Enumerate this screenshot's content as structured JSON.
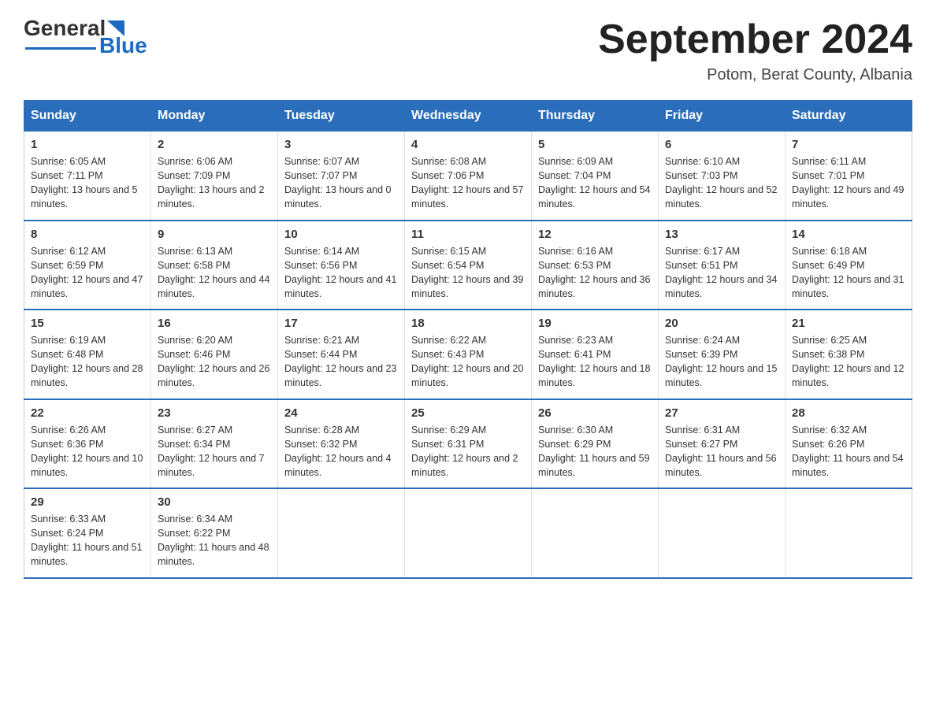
{
  "header": {
    "logo_general": "General",
    "logo_blue": "Blue",
    "month_title": "September 2024",
    "location": "Potom, Berat County, Albania"
  },
  "weekdays": [
    "Sunday",
    "Monday",
    "Tuesday",
    "Wednesday",
    "Thursday",
    "Friday",
    "Saturday"
  ],
  "weeks": [
    [
      {
        "day": "1",
        "sunrise": "6:05 AM",
        "sunset": "7:11 PM",
        "daylight": "13 hours and 5 minutes."
      },
      {
        "day": "2",
        "sunrise": "6:06 AM",
        "sunset": "7:09 PM",
        "daylight": "13 hours and 2 minutes."
      },
      {
        "day": "3",
        "sunrise": "6:07 AM",
        "sunset": "7:07 PM",
        "daylight": "13 hours and 0 minutes."
      },
      {
        "day": "4",
        "sunrise": "6:08 AM",
        "sunset": "7:06 PM",
        "daylight": "12 hours and 57 minutes."
      },
      {
        "day": "5",
        "sunrise": "6:09 AM",
        "sunset": "7:04 PM",
        "daylight": "12 hours and 54 minutes."
      },
      {
        "day": "6",
        "sunrise": "6:10 AM",
        "sunset": "7:03 PM",
        "daylight": "12 hours and 52 minutes."
      },
      {
        "day": "7",
        "sunrise": "6:11 AM",
        "sunset": "7:01 PM",
        "daylight": "12 hours and 49 minutes."
      }
    ],
    [
      {
        "day": "8",
        "sunrise": "6:12 AM",
        "sunset": "6:59 PM",
        "daylight": "12 hours and 47 minutes."
      },
      {
        "day": "9",
        "sunrise": "6:13 AM",
        "sunset": "6:58 PM",
        "daylight": "12 hours and 44 minutes."
      },
      {
        "day": "10",
        "sunrise": "6:14 AM",
        "sunset": "6:56 PM",
        "daylight": "12 hours and 41 minutes."
      },
      {
        "day": "11",
        "sunrise": "6:15 AM",
        "sunset": "6:54 PM",
        "daylight": "12 hours and 39 minutes."
      },
      {
        "day": "12",
        "sunrise": "6:16 AM",
        "sunset": "6:53 PM",
        "daylight": "12 hours and 36 minutes."
      },
      {
        "day": "13",
        "sunrise": "6:17 AM",
        "sunset": "6:51 PM",
        "daylight": "12 hours and 34 minutes."
      },
      {
        "day": "14",
        "sunrise": "6:18 AM",
        "sunset": "6:49 PM",
        "daylight": "12 hours and 31 minutes."
      }
    ],
    [
      {
        "day": "15",
        "sunrise": "6:19 AM",
        "sunset": "6:48 PM",
        "daylight": "12 hours and 28 minutes."
      },
      {
        "day": "16",
        "sunrise": "6:20 AM",
        "sunset": "6:46 PM",
        "daylight": "12 hours and 26 minutes."
      },
      {
        "day": "17",
        "sunrise": "6:21 AM",
        "sunset": "6:44 PM",
        "daylight": "12 hours and 23 minutes."
      },
      {
        "day": "18",
        "sunrise": "6:22 AM",
        "sunset": "6:43 PM",
        "daylight": "12 hours and 20 minutes."
      },
      {
        "day": "19",
        "sunrise": "6:23 AM",
        "sunset": "6:41 PM",
        "daylight": "12 hours and 18 minutes."
      },
      {
        "day": "20",
        "sunrise": "6:24 AM",
        "sunset": "6:39 PM",
        "daylight": "12 hours and 15 minutes."
      },
      {
        "day": "21",
        "sunrise": "6:25 AM",
        "sunset": "6:38 PM",
        "daylight": "12 hours and 12 minutes."
      }
    ],
    [
      {
        "day": "22",
        "sunrise": "6:26 AM",
        "sunset": "6:36 PM",
        "daylight": "12 hours and 10 minutes."
      },
      {
        "day": "23",
        "sunrise": "6:27 AM",
        "sunset": "6:34 PM",
        "daylight": "12 hours and 7 minutes."
      },
      {
        "day": "24",
        "sunrise": "6:28 AM",
        "sunset": "6:32 PM",
        "daylight": "12 hours and 4 minutes."
      },
      {
        "day": "25",
        "sunrise": "6:29 AM",
        "sunset": "6:31 PM",
        "daylight": "12 hours and 2 minutes."
      },
      {
        "day": "26",
        "sunrise": "6:30 AM",
        "sunset": "6:29 PM",
        "daylight": "11 hours and 59 minutes."
      },
      {
        "day": "27",
        "sunrise": "6:31 AM",
        "sunset": "6:27 PM",
        "daylight": "11 hours and 56 minutes."
      },
      {
        "day": "28",
        "sunrise": "6:32 AM",
        "sunset": "6:26 PM",
        "daylight": "11 hours and 54 minutes."
      }
    ],
    [
      {
        "day": "29",
        "sunrise": "6:33 AM",
        "sunset": "6:24 PM",
        "daylight": "11 hours and 51 minutes."
      },
      {
        "day": "30",
        "sunrise": "6:34 AM",
        "sunset": "6:22 PM",
        "daylight": "11 hours and 48 minutes."
      },
      null,
      null,
      null,
      null,
      null
    ]
  ]
}
